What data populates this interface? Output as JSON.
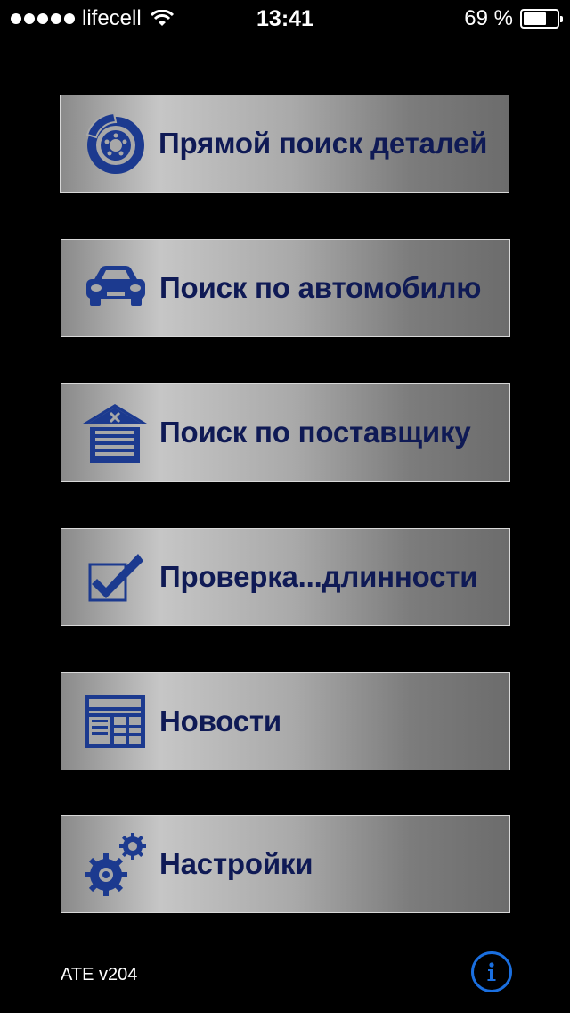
{
  "status_bar": {
    "carrier": "lifecell",
    "time": "13:41",
    "battery_percent_text": "69 %",
    "battery_level": 0.69
  },
  "menu": {
    "items": [
      {
        "id": "direct-search",
        "label": "Прямой поиск деталей",
        "icon": "brake-disc-icon"
      },
      {
        "id": "vehicle-search",
        "label": "Поиск по автомобилю",
        "icon": "car-icon"
      },
      {
        "id": "supplier-search",
        "label": "Поиск по поставщику",
        "icon": "garage-icon"
      },
      {
        "id": "authenticity-check",
        "label": "Проверка...длинности",
        "icon": "checkbox-icon"
      },
      {
        "id": "news",
        "label": "Новости",
        "icon": "newspaper-icon"
      },
      {
        "id": "settings",
        "label": "Настройки",
        "icon": "gears-icon"
      }
    ]
  },
  "footer": {
    "version": "ATE v204",
    "info_icon": "info-icon"
  },
  "colors": {
    "label": "#0f1a55",
    "icon": "#1c3a8f",
    "info": "#1a6fe0"
  }
}
